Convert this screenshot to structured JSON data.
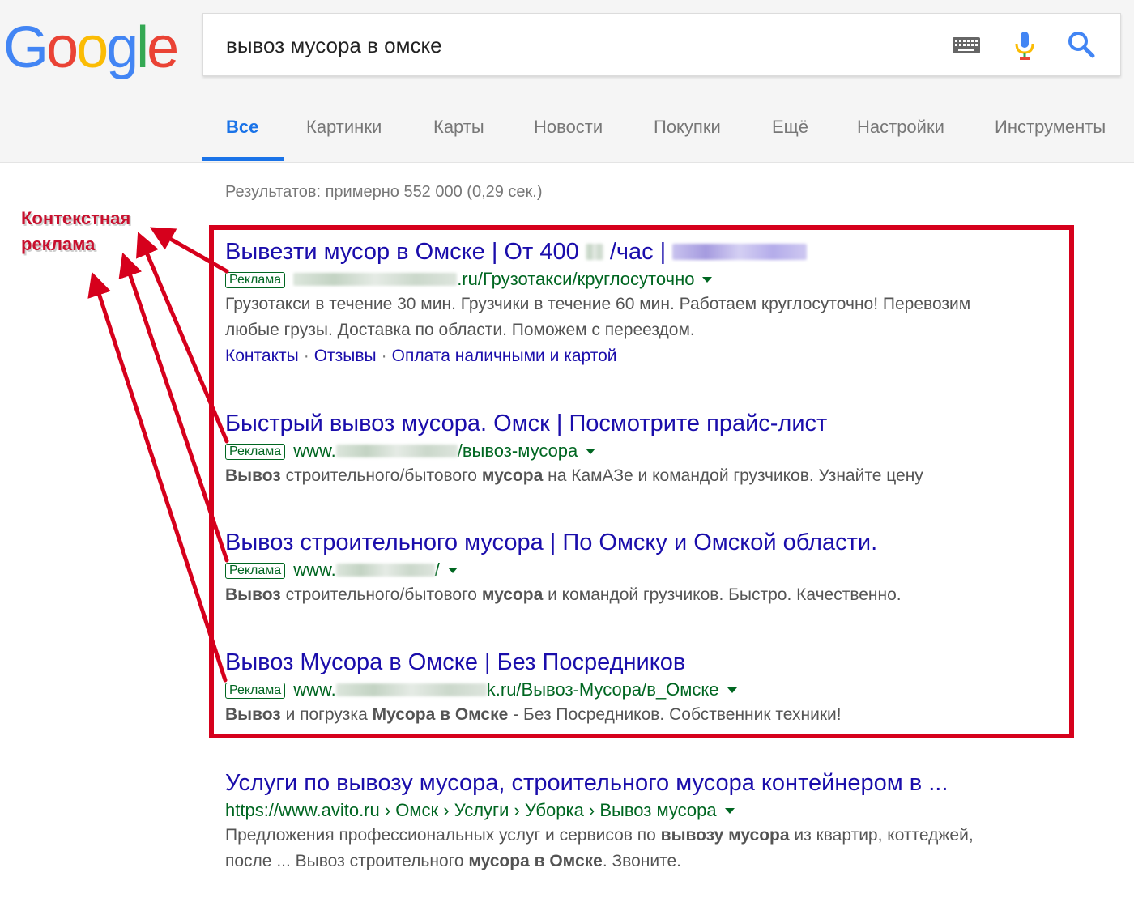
{
  "logo": {
    "letters": [
      "G",
      "o",
      "o",
      "g",
      "l",
      "e"
    ],
    "colors": [
      "#4285f4",
      "#ea4335",
      "#fbbc05",
      "#4285f4",
      "#34a853",
      "#ea4335"
    ]
  },
  "search": {
    "query": "вывоз мусора в омске"
  },
  "tabs": [
    "Все",
    "Картинки",
    "Карты",
    "Новости",
    "Покупки",
    "Ещё",
    "Настройки",
    "Инструменты"
  ],
  "stats": "Результатов: примерно 552 000 (0,29 сек.)",
  "annotation": {
    "line1": "Контекстная",
    "line2": "реклама",
    "color": "#c8102e"
  },
  "ad_label": "Реклама",
  "ads": [
    {
      "title_a": "Вывезти мусор в Омске | От 400",
      "title_b": "/час |",
      "url_b": ".ru/Грузотакси/круглосуточно",
      "snippet_1": "Грузотакси в течение 30 мин. Грузчики в течение 60 мин. Работаем круглосуточно! Перевозим",
      "snippet_2": "любые грузы. Доставка по области. Поможем с переездом.",
      "sitelinks": [
        "Контакты",
        "Отзывы",
        "Оплата наличными и картой"
      ]
    },
    {
      "title": "Быстрый вывоз мусора. Омск | Посмотрите прайс-лист",
      "url_a": "www.",
      "url_b": "/вывоз-мусора",
      "s1": "Вывоз",
      "s2": " строительного/бытового ",
      "s3": "мусора",
      "s4": " на КамАЗе и командой грузчиков. Узнайте цену"
    },
    {
      "title": "Вывоз строительного мусора | По Омску и Омской области.",
      "url_a": "www.",
      "url_b": "/",
      "s1": "Вывоз",
      "s2": " строительного/бытового ",
      "s3": "мусора",
      "s4": " и командой грузчиков. Быстро. Качественно."
    },
    {
      "title": "Вывоз Мусора в Омске | Без Посредников",
      "url_a": "www.",
      "url_b": "k.ru/Вывоз-Мусора/в_Омске",
      "s1": "Вывоз",
      "s2": " и погрузка ",
      "s3": "Мусора в Омске",
      "s4": " - Без Посредников. Собственник техники!"
    }
  ],
  "organic": {
    "title": "Услуги по вывозу мусора, строительного мусора контейнером в ...",
    "url": "https://www.avito.ru › Омск › Услуги › Уборка › Вывоз мусора",
    "l1a": "Предложения профессиональных услуг и сервисов по ",
    "l1b": "вывозу мусора",
    "l1c": " из квартир, коттеджей,",
    "l2a": "после ... Вывоз строительного ",
    "l2b": "мусора в Омске",
    "l2c": ". Звоните."
  }
}
